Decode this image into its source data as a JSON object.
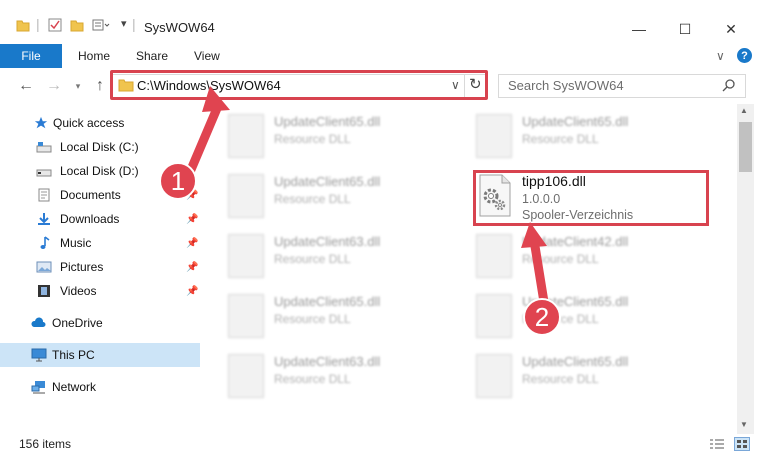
{
  "window": {
    "title": "SysWOW64",
    "minimize": "—",
    "maximize": "☐",
    "close": "✕"
  },
  "ribbon": {
    "tabs": [
      "File",
      "Home",
      "Share",
      "View"
    ],
    "help": "?",
    "collapse": "∨"
  },
  "address": {
    "path": "C:\\Windows\\SysWOW64",
    "dropdown": "∨",
    "refresh": "↻"
  },
  "search": {
    "placeholder": "Search SysWOW64"
  },
  "sidebar": {
    "items": [
      {
        "label": "Quick access",
        "icon": "star-icon",
        "pinned": false
      },
      {
        "label": "Local Disk (C:)",
        "icon": "drive-icon",
        "pinned": false
      },
      {
        "label": "Local Disk (D:)",
        "icon": "drive-icon",
        "pinned": false
      },
      {
        "label": "Documents",
        "icon": "documents-icon",
        "pinned": true
      },
      {
        "label": "Downloads",
        "icon": "download-icon",
        "pinned": true
      },
      {
        "label": "Music",
        "icon": "music-icon",
        "pinned": true
      },
      {
        "label": "Pictures",
        "icon": "pictures-icon",
        "pinned": true
      },
      {
        "label": "Videos",
        "icon": "videos-icon",
        "pinned": true
      },
      {
        "label": "OneDrive",
        "icon": "cloud-icon",
        "pinned": false
      },
      {
        "label": "This PC",
        "icon": "computer-icon",
        "pinned": false,
        "selected": true
      },
      {
        "label": "Network",
        "icon": "network-icon",
        "pinned": false
      }
    ]
  },
  "files": {
    "left": [
      {
        "name": "UpdateClient65.dll",
        "desc": "Resource DLL"
      },
      {
        "name": "UpdateClient65.dll",
        "desc": "Resource DLL"
      },
      {
        "name": "UpdateClient63.dll",
        "desc": "Resource DLL"
      },
      {
        "name": "UpdateClient65.dll",
        "desc": "Resource DLL"
      },
      {
        "name": "UpdateClient63.dll",
        "desc": "Resource DLL"
      }
    ],
    "right": [
      {
        "name": "UpdateClient65.dll",
        "desc": "Resource DLL"
      },
      {
        "name": "UpdateClient42.dll",
        "desc": "Resource DLL"
      },
      {
        "name": "UpdateClient65.dll",
        "desc": "Resource DLL"
      },
      {
        "name": "UpdateClient65.dll",
        "desc": "Resource DLL"
      }
    ],
    "highlighted": {
      "name": "tipp106.dll",
      "version": "1.0.0.0",
      "desc": "Spooler-Verzeichnis"
    }
  },
  "status": {
    "count": "156 items"
  },
  "annotations": {
    "step1": "1",
    "step2": "2"
  },
  "colors": {
    "accent": "#1979ca",
    "highlight": "#d8434f",
    "selected_bg": "#cce4f7"
  }
}
